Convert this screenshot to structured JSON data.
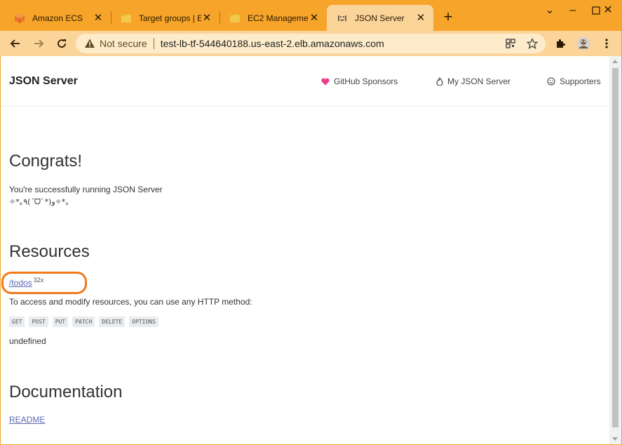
{
  "tabs": [
    {
      "title": "Amazon ECS",
      "icon": "aws-cube-icon"
    },
    {
      "title": "Target groups | E",
      "icon": "folder-icon"
    },
    {
      "title": "EC2 Managemen",
      "icon": "folder-icon"
    },
    {
      "title": "JSON Server",
      "icon": "json-server-face-icon"
    }
  ],
  "toolbar": {
    "security_label": "Not secure",
    "url": "test-lb-tf-544640188.us-east-2.elb.amazonaws.com"
  },
  "site": {
    "brand": "JSON Server",
    "nav": [
      {
        "label": "GitHub Sponsors",
        "icon": "heart-icon"
      },
      {
        "label": "My JSON Server",
        "icon": "flame-icon"
      },
      {
        "label": "Supporters",
        "icon": "smile-icon"
      }
    ]
  },
  "content": {
    "congrats_heading": "Congrats!",
    "success_line": "You're successfully running JSON Server",
    "kaomoji": "✧*｡٩(ˊᗜˋ*)و✧*｡",
    "resources_heading": "Resources",
    "resource_link": "/todos",
    "resource_count": "32x",
    "access_text": "To access and modify resources, you can use any HTTP method:",
    "methods": [
      "GET",
      "POST",
      "PUT",
      "PATCH",
      "DELETE",
      "OPTIONS"
    ],
    "undefined_text": "undefined",
    "documentation_heading": "Documentation",
    "readme_link": "README"
  },
  "colors": {
    "tab_strip": "#f7a42b",
    "active_tab": "#fbd49a",
    "annotation": "#f07a1e",
    "link": "#5a6ab0",
    "heart": "#e83e8c"
  }
}
